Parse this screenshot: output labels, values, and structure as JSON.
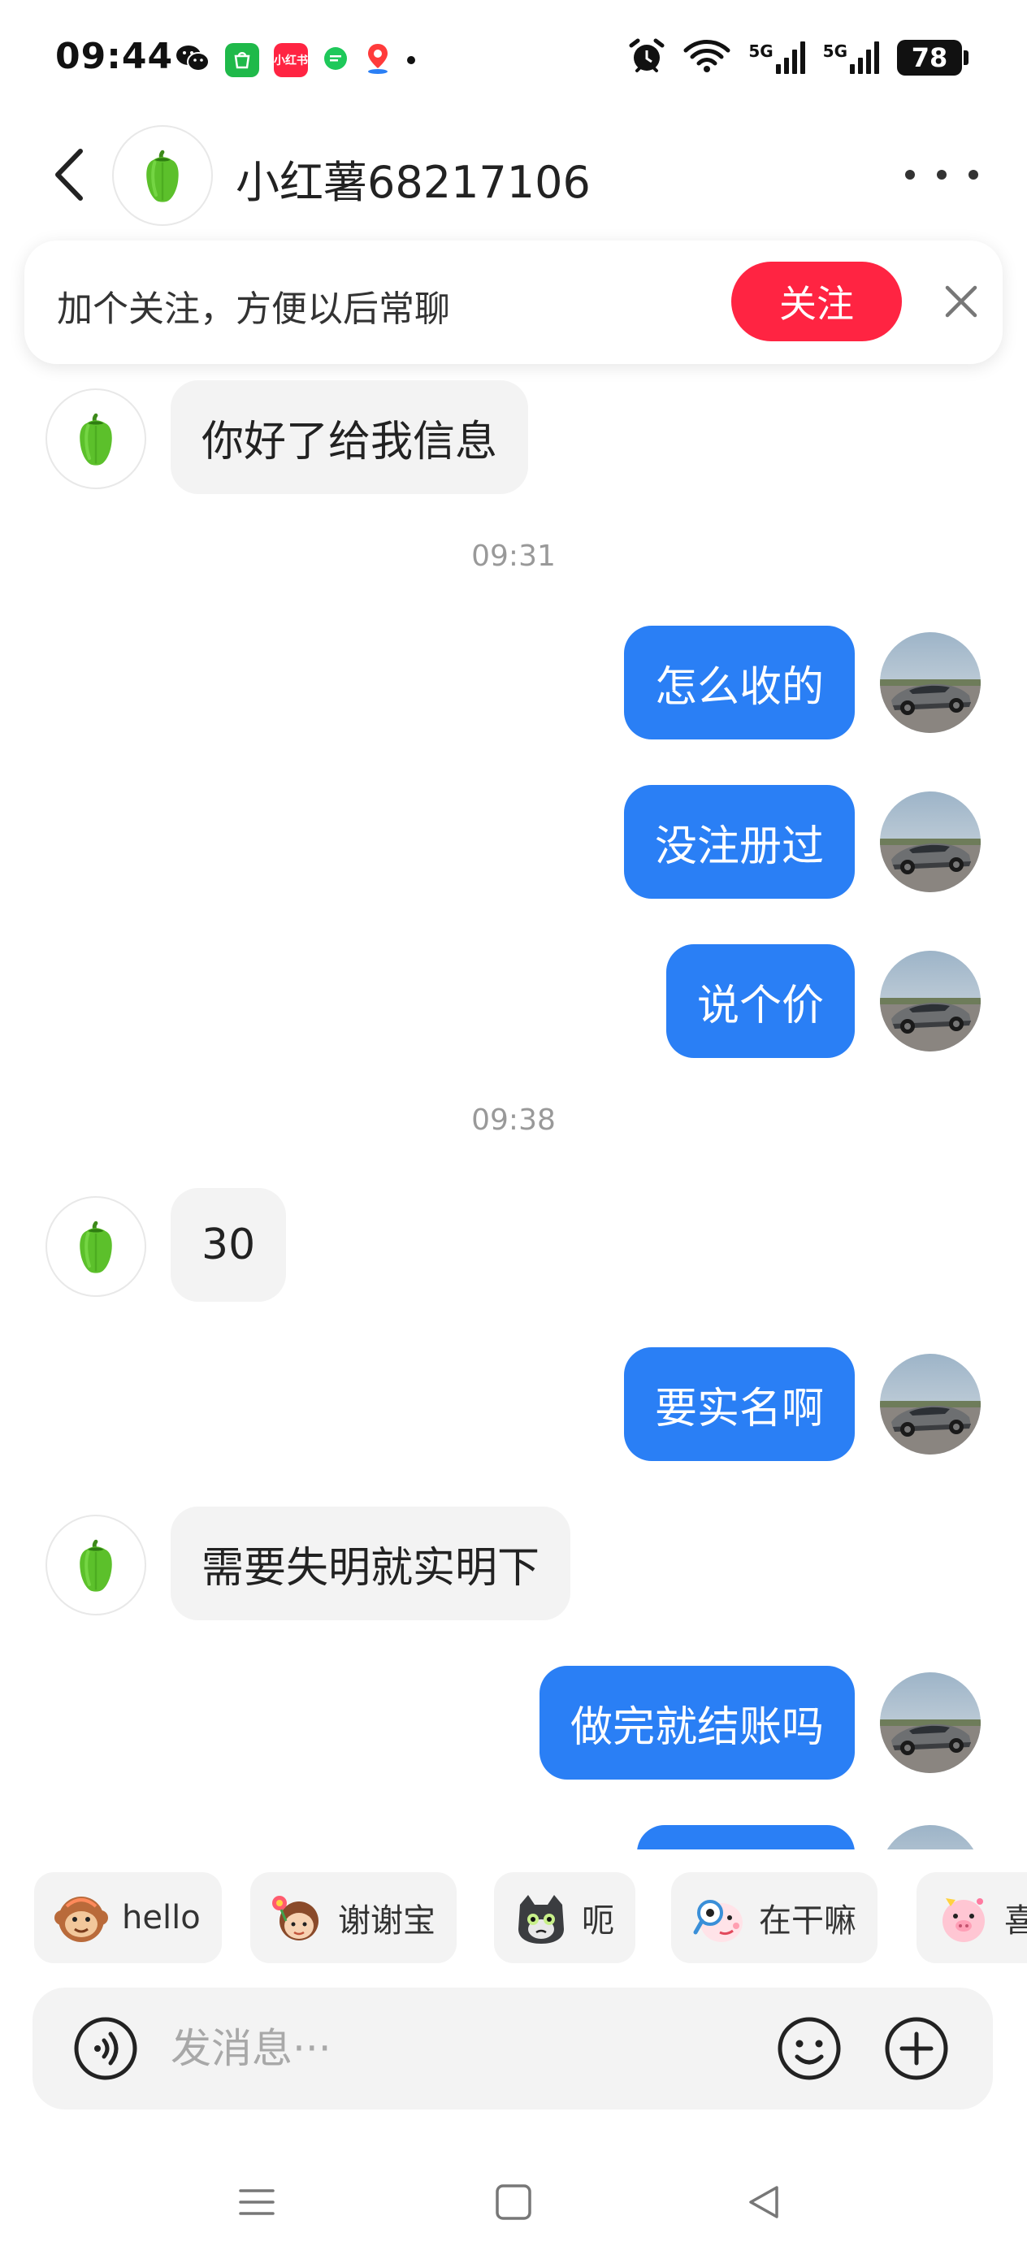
{
  "status_bar": {
    "time": "09:44",
    "app_icons": [
      "wechat-icon",
      "app-store-icon",
      "xiaohongshu-icon",
      "message-icon",
      "map-icon"
    ],
    "xiaohongshu_badge": "小红书",
    "network_1": "5G",
    "network_2": "5G",
    "battery": "78"
  },
  "header": {
    "title": "小红薯68217106"
  },
  "follow_banner": {
    "text": "加个关注，方便以后常聊",
    "button_label": "关注"
  },
  "messages": [
    {
      "side": "left",
      "text": "你好了给我信息"
    },
    {
      "type": "time",
      "text": "09:31"
    },
    {
      "side": "right",
      "text": "怎么收的"
    },
    {
      "side": "right",
      "text": "没注册过"
    },
    {
      "side": "right",
      "text": "说个价"
    },
    {
      "type": "time",
      "text": "09:38"
    },
    {
      "side": "left",
      "text": "30"
    },
    {
      "side": "right",
      "text": "要实名啊"
    },
    {
      "side": "left",
      "text": "需要失明就实明下"
    },
    {
      "side": "right",
      "text": "做完就结账吗"
    }
  ],
  "quick_replies": [
    {
      "label": "hello",
      "icon": "monkey-sticker-icon"
    },
    {
      "label": "谢谢宝",
      "icon": "girl-flower-sticker-icon"
    },
    {
      "label": "呃",
      "icon": "cat-sticker-icon"
    },
    {
      "label": "在干嘛",
      "icon": "magnifier-sticker-icon"
    },
    {
      "label": "喜",
      "icon": "pig-sticker-icon"
    }
  ],
  "input": {
    "placeholder": "发消息···"
  },
  "colors": {
    "accent_blue": "#2a7ff5",
    "follow_red": "#ff2442",
    "bubble_gray": "#f3f3f3"
  }
}
